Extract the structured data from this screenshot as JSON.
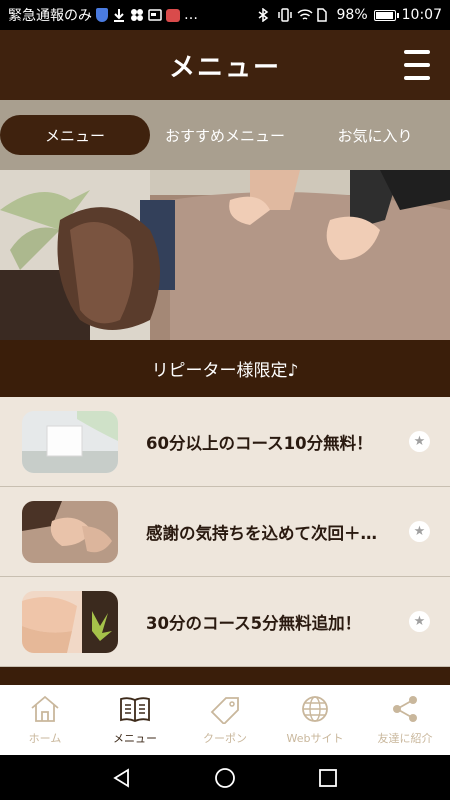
{
  "status_bar": {
    "notification_text": "緊急通報のみ",
    "more_indicator": "…",
    "battery": "98%",
    "time": "10:07"
  },
  "header": {
    "title": "メニュー",
    "menu_icon": "hamburger-icon"
  },
  "tabs": [
    {
      "label": "メニュー",
      "active": true
    },
    {
      "label": "おすすめメニュー",
      "active": false
    },
    {
      "label": "お気に入り",
      "active": false
    }
  ],
  "section": {
    "title": "リピーター様限定♪"
  },
  "list_items": [
    {
      "text": "60分以上のコース10分無料！",
      "icon": "star-icon"
    },
    {
      "text": "感謝の気持ちを込めて次回＋…",
      "icon": "star-icon"
    },
    {
      "text": "30分のコース5分無料追加！",
      "icon": "star-icon"
    }
  ],
  "bottom_nav": [
    {
      "label": "ホーム",
      "icon": "home-icon",
      "active": false
    },
    {
      "label": "メニュー",
      "icon": "book-icon",
      "active": true
    },
    {
      "label": "クーポン",
      "icon": "coupon-tag-icon",
      "active": false
    },
    {
      "label": "Webサイト",
      "icon": "globe-icon",
      "active": false
    },
    {
      "label": "友達に紹介",
      "icon": "share-icon",
      "active": false
    }
  ],
  "colors": {
    "header_bg": "#3f220e",
    "tab_bar_bg": "#a99f8f",
    "list_bg": "#eee6dc",
    "nav_inactive": "#c9b79c"
  }
}
